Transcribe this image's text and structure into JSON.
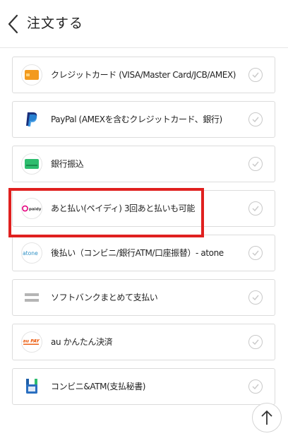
{
  "header": {
    "title": "注文する"
  },
  "payment_methods": [
    {
      "label": "クレジットカード (VISA/Master Card/JCB/AMEX)",
      "icon": "credit-card-icon",
      "color": "#f39a1e"
    },
    {
      "label": "PayPal (AMEXを含むクレジットカード、銀行)",
      "icon": "paypal-icon",
      "color": "#1a2f7a"
    },
    {
      "label": "銀行振込",
      "icon": "bank-card-icon",
      "color": "#2dbd6e"
    },
    {
      "label": "あと払い(ペイディ) 3回あと払いも可能",
      "icon": "paidy-icon",
      "logo_text": "paidy",
      "color": "#e5007e"
    },
    {
      "label": "後払い（コンビニ/銀行ATM/口座振替）- atone",
      "icon": "atone-icon",
      "logo_text": "atone",
      "color": "#2d8fc4"
    },
    {
      "label": "ソフトバンクまとめて支払い",
      "icon": "softbank-icon",
      "color": "#b5b5b5"
    },
    {
      "label": "au かんたん決済",
      "icon": "au-pay-icon",
      "logo_text": "au PAY",
      "color": "#eb5505"
    },
    {
      "label": "コンビニ&ATM(支払秘書)",
      "icon": "convenience-store-icon",
      "color": "#1f5fa8"
    }
  ]
}
